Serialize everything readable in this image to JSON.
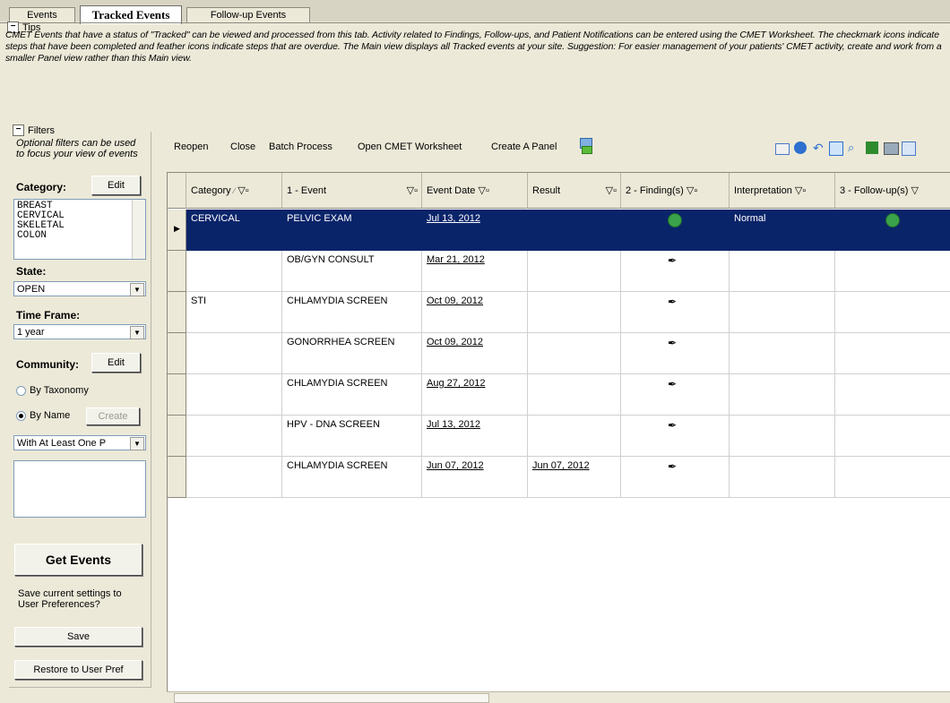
{
  "tabs": [
    "Events",
    "Tracked Events",
    "Follow-up Events"
  ],
  "tips": {
    "legend": "Tips",
    "text": "CMET Events that have a status of \"Tracked\" can be viewed and processed from this tab.  Activity related to Findings, Follow-ups, and Patient Notifications can be entered using the CMET Worksheet.  The checkmark icons indicate steps that have been completed and feather icons indicate steps that are overdue. The Main view displays all Tracked events at your site.  Suggestion:  For easier management of your patients' CMET activity, create and work from a smaller Panel view rather than this Main view."
  },
  "filters": {
    "legend": "Filters",
    "hint": "Optional filters can be used to focus your view of events",
    "category_label": "Category:",
    "edit_label": "Edit",
    "categories": [
      "BREAST",
      "CERVICAL",
      "SKELETAL",
      "COLON"
    ],
    "state_label": "State:",
    "state_value": "OPEN",
    "timeframe_label": "Time Frame:",
    "timeframe_value": "1 year",
    "community_label": "Community:",
    "community_edit": "Edit",
    "by_taxonomy": "By Taxonomy",
    "by_name": "By Name",
    "create_label": "Create",
    "with_value": "With At Least One P",
    "get_events": "Get Events",
    "save_prompt": "Save current settings to User Preferences?",
    "save_label": "Save",
    "restore_label": "Restore  to User Pref"
  },
  "toolbar": {
    "reopen": "Reopen",
    "close": "Close",
    "batch": "Batch Process",
    "worksheet": "Open CMET Worksheet",
    "panel": "Create A Panel"
  },
  "grid": {
    "columns": [
      "Category",
      "1 - Event",
      "Event Date",
      "Result",
      "2 - Finding(s)",
      "Interpretation",
      "3 - Follow-up(s)"
    ],
    "rows": [
      {
        "category": "CERVICAL",
        "event": "PELVIC EXAM",
        "date": "Jul 13, 2012",
        "result": "",
        "finding": "check",
        "interp": "Normal",
        "followup": "check"
      },
      {
        "category": "",
        "event": "OB/GYN CONSULT",
        "date": "Mar 21, 2012",
        "result": "",
        "finding": "feather",
        "interp": "",
        "followup": ""
      },
      {
        "category": "STI",
        "event": "CHLAMYDIA SCREEN",
        "date": "Oct 09, 2012",
        "result": "",
        "finding": "feather",
        "interp": "",
        "followup": ""
      },
      {
        "category": "",
        "event": "GONORRHEA SCREEN",
        "date": "Oct 09, 2012",
        "result": "",
        "finding": "feather",
        "interp": "",
        "followup": ""
      },
      {
        "category": "",
        "event": "CHLAMYDIA SCREEN",
        "date": "Aug 27, 2012",
        "result": "",
        "finding": "feather",
        "interp": "",
        "followup": ""
      },
      {
        "category": "",
        "event": "HPV - DNA SCREEN",
        "date": "Jul 13, 2012",
        "result": "",
        "finding": "feather",
        "interp": "",
        "followup": ""
      },
      {
        "category": "",
        "event": "CHLAMYDIA SCREEN",
        "date": "Jun 07, 2012",
        "result": "Jun 07, 2012",
        "finding": "feather",
        "interp": "",
        "followup": ""
      }
    ]
  }
}
